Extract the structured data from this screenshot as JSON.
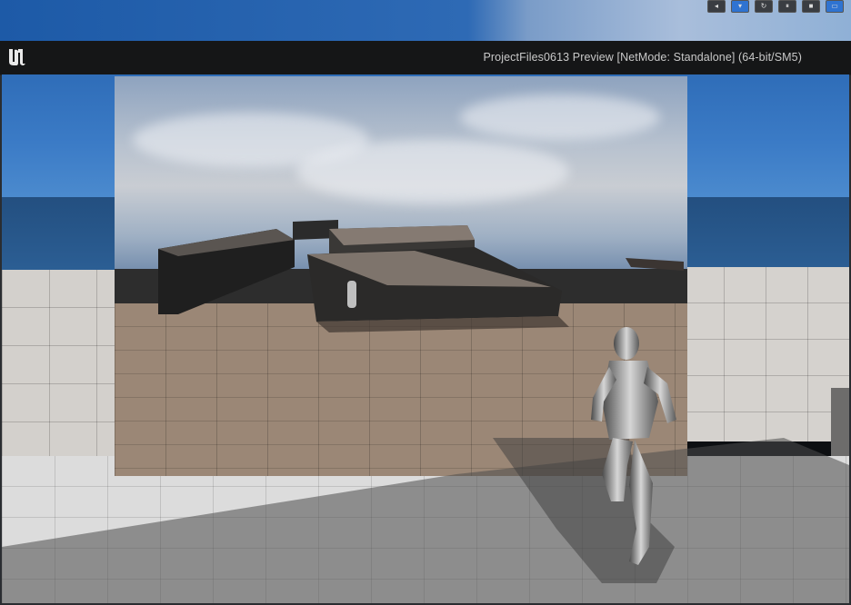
{
  "window": {
    "title": "ProjectFiles0613 Preview [NetMode: Standalone]  (64-bit/SM5)"
  },
  "editor_toolbar": {
    "buttons": [
      "play-icon",
      "settings-icon",
      "restart-icon",
      "pause-icon",
      "stop-icon",
      "window-icon"
    ]
  },
  "viewport": {
    "scene": "third-person level preview"
  },
  "colors": {
    "title_bar": "#151617",
    "title_text": "#c9c9c9",
    "accent": "#2f73d1"
  }
}
